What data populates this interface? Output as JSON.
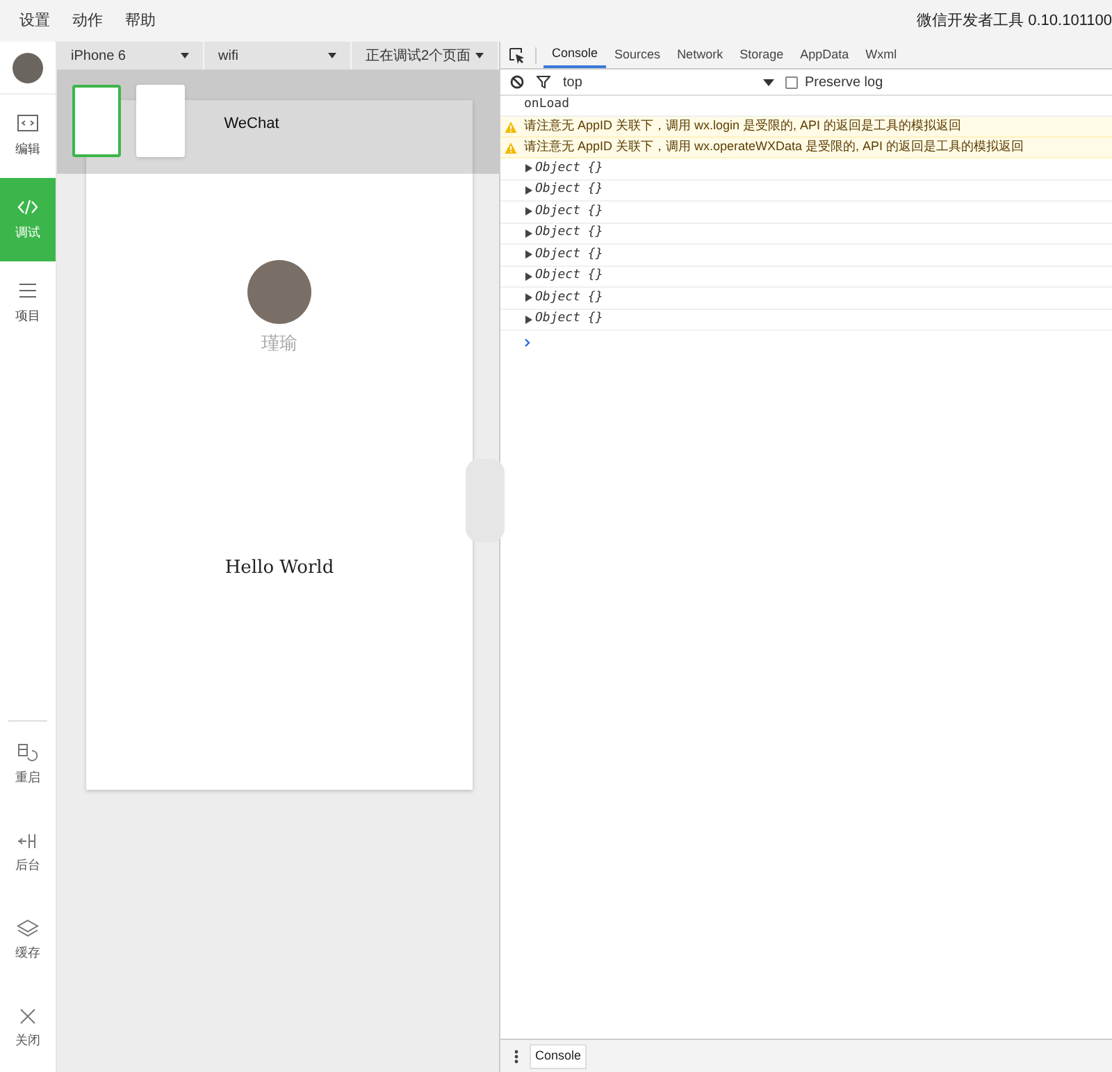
{
  "menu": [
    "设置",
    "动作",
    "帮助"
  ],
  "app_title": "微信开发者工具 0.10.101100",
  "sidebar": {
    "items": [
      {
        "label": "编辑",
        "selected": false
      },
      {
        "label": "调试",
        "selected": true
      },
      {
        "label": "项目",
        "selected": false
      }
    ],
    "bottom_items": [
      {
        "label": "重启"
      },
      {
        "label": "后台"
      },
      {
        "label": "缓存"
      },
      {
        "label": "关闭"
      }
    ]
  },
  "simulator": {
    "dropdowns": [
      {
        "value": "iPhone 6"
      },
      {
        "value": "wifi"
      },
      {
        "value": "正在调试2个页面"
      }
    ],
    "pages": [
      {
        "selected": true
      },
      {
        "selected": false
      }
    ],
    "nav_title": "WeChat",
    "user_name": "瑾瑜",
    "text": "Hello World"
  },
  "devtools": {
    "tabs": [
      {
        "label": "Console",
        "selected": true
      },
      {
        "label": "Sources",
        "selected": false
      },
      {
        "label": "Network",
        "selected": false
      },
      {
        "label": "Storage",
        "selected": false
      },
      {
        "label": "AppData",
        "selected": false
      },
      {
        "label": "Wxml",
        "selected": false
      }
    ],
    "context": "top",
    "preserve_log": {
      "label": "Preserve log",
      "checked": false
    },
    "console": [
      {
        "kind": "log",
        "text": "onLoad"
      },
      {
        "kind": "warning",
        "text": "请注意无 AppID 关联下，调用 wx.login 是受限的, API 的返回是工具的模拟返回"
      },
      {
        "kind": "warning",
        "text": "请注意无 AppID 关联下，调用 wx.operateWXData 是受限的, API 的返回是工具的模拟返回"
      },
      {
        "kind": "object",
        "text": "Object {}"
      },
      {
        "kind": "object",
        "text": "Object {}"
      },
      {
        "kind": "object",
        "text": "Object {}"
      },
      {
        "kind": "object",
        "text": "Object {}"
      },
      {
        "kind": "object",
        "text": "Object {}"
      },
      {
        "kind": "object",
        "text": "Object {}"
      },
      {
        "kind": "object",
        "text": "Object {}"
      },
      {
        "kind": "object",
        "text": "Object {}"
      }
    ],
    "drawer_tab": "Console"
  }
}
